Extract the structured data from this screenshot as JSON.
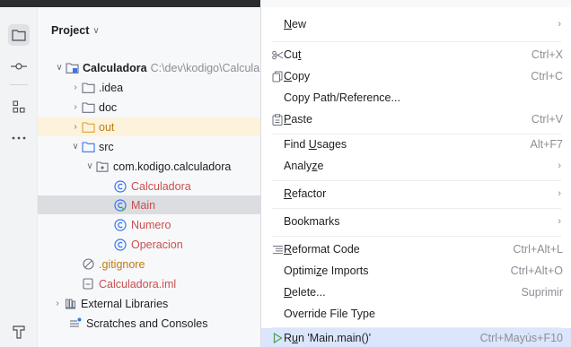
{
  "toolstrip": {
    "items": [
      {
        "name": "project-tool-icon",
        "active": true
      },
      {
        "name": "commit-tool-icon",
        "active": false
      },
      {
        "name": "structure-tool-icon",
        "active": false
      },
      {
        "name": "more-tools-icon",
        "active": false
      },
      {
        "name": "build-tool-icon",
        "active": false
      }
    ]
  },
  "project_panel": {
    "title": "Project",
    "chevron": "∨",
    "tree": [
      {
        "label": "Calculadora",
        "path": "C:\\dev\\kodigo\\Calcula",
        "arrow": "∨",
        "icon": "module-folder-icon"
      },
      {
        "label": ".idea",
        "arrow": "›",
        "icon": "folder-icon"
      },
      {
        "label": "doc",
        "arrow": "›",
        "icon": "folder-icon"
      },
      {
        "label": "out",
        "arrow": "›",
        "icon": "excluded-folder-icon"
      },
      {
        "label": "src",
        "arrow": "∨",
        "icon": "source-folder-icon"
      },
      {
        "label": "com.kodigo.calculadora",
        "arrow": "∨",
        "icon": "package-icon"
      },
      {
        "label": "Calculadora",
        "icon": "class-icon"
      },
      {
        "label": "Main",
        "icon": "runnable-class-icon"
      },
      {
        "label": "Numero",
        "icon": "class-icon"
      },
      {
        "label": "Operacion",
        "icon": "class-icon"
      },
      {
        "label": ".gitignore",
        "icon": "ignore-file-icon"
      },
      {
        "label": "Calculadora.iml",
        "icon": "iml-file-icon"
      },
      {
        "label": "External Libraries",
        "arrow": "›",
        "icon": "library-icon"
      },
      {
        "label": "Scratches and Consoles",
        "icon": "scratches-icon"
      }
    ]
  },
  "context_menu": {
    "new": {
      "pre": "",
      "mn": "N",
      "post": "ew",
      "sub": "›"
    },
    "cut": {
      "pre": "Cu",
      "mn": "t",
      "post": "",
      "shortcut": "Ctrl+X"
    },
    "copy": {
      "pre": "",
      "mn": "C",
      "post": "opy",
      "shortcut": "Ctrl+C"
    },
    "copy_path": {
      "label": "Copy Path/Reference..."
    },
    "paste": {
      "pre": "",
      "mn": "P",
      "post": "aste",
      "shortcut": "Ctrl+V"
    },
    "find_usages": {
      "pre": "Find ",
      "mn": "U",
      "post": "sages",
      "shortcut": "Alt+F7"
    },
    "analyze": {
      "pre": "Analy",
      "mn": "z",
      "post": "e",
      "sub": "›"
    },
    "refactor": {
      "pre": "",
      "mn": "R",
      "post": "efactor",
      "sub": "›"
    },
    "bookmarks": {
      "label": "Bookmarks",
      "sub": "›"
    },
    "reformat": {
      "pre": "",
      "mn": "R",
      "post": "eformat Code",
      "shortcut": "Ctrl+Alt+L"
    },
    "optimize": {
      "pre": "Optimi",
      "mn": "z",
      "post": "e Imports",
      "shortcut": "Ctrl+Alt+O"
    },
    "delete": {
      "pre": "",
      "mn": "D",
      "post": "elete...",
      "shortcut": "Suprimir"
    },
    "override": {
      "label": "Override File Type"
    },
    "run": {
      "pre": "R",
      "mn": "u",
      "post": "n 'Main.main()'",
      "shortcut": "Ctrl+Mayús+F10"
    }
  }
}
